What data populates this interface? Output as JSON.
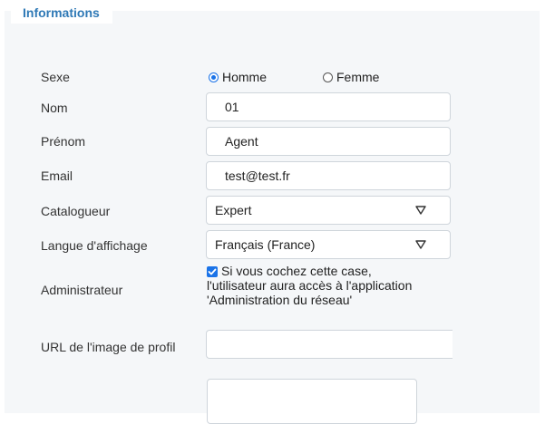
{
  "section": {
    "title": "Informations"
  },
  "sexe": {
    "label": "Sexe",
    "options": [
      {
        "label": "Homme",
        "checked": true
      },
      {
        "label": "Femme",
        "checked": false
      }
    ]
  },
  "nom": {
    "label": "Nom",
    "value": "01"
  },
  "prenom": {
    "label": "Prénom",
    "value": "Agent"
  },
  "email": {
    "label": "Email",
    "value": "test@test.fr"
  },
  "catalogueur": {
    "label": "Catalogueur",
    "value": "Expert"
  },
  "langue": {
    "label": "Langue d'affichage",
    "value": "Français (France)"
  },
  "administrateur": {
    "label": "Administrateur",
    "checked": true,
    "line1": "Si vous cochez cette case,",
    "line2": "l'utilisateur aura accès à l'application",
    "line3": "'Administration du réseau'"
  },
  "url_image": {
    "label": "URL de l'image de profil",
    "value": ""
  },
  "colors": {
    "accent": "#2f79b6",
    "checkbox": "#1a73e8",
    "panel_bg": "#f5f7f9"
  }
}
